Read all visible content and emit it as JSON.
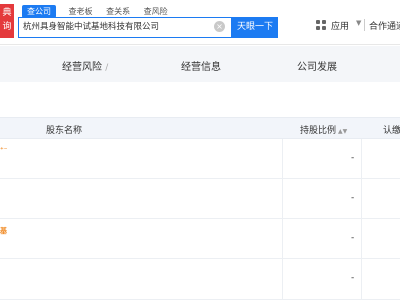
{
  "logo": {
    "text": "典\n询"
  },
  "search": {
    "tabs": [
      {
        "label": "查公司",
        "active": true
      },
      {
        "label": "查老板",
        "active": false
      },
      {
        "label": "查关系",
        "active": false
      },
      {
        "label": "查风险",
        "active": false
      }
    ],
    "value": "杭州具身智能中试基地科技有限公司",
    "button_label": "天眼一下"
  },
  "header": {
    "apps_label": "应用",
    "coop_label": "合作通道"
  },
  "nav": {
    "items": [
      {
        "label": "经营风险"
      },
      {
        "label": "经营信息"
      },
      {
        "label": "公司发展"
      }
    ],
    "slash": "/"
  },
  "table": {
    "columns": {
      "shareholder": "股东名称",
      "ratio": "持股比例",
      "subscribed": "认缴"
    },
    "rows": [
      {
        "tag": "⁺⁻",
        "ratio": "-"
      },
      {
        "tag": "",
        "ratio": "-"
      },
      {
        "tag": "基",
        "ratio": "-"
      },
      {
        "tag": "",
        "ratio": "-"
      }
    ]
  },
  "colors": {
    "accent": "#1c7bf2",
    "brand": "#e4393c",
    "tag": "#f08a24"
  }
}
